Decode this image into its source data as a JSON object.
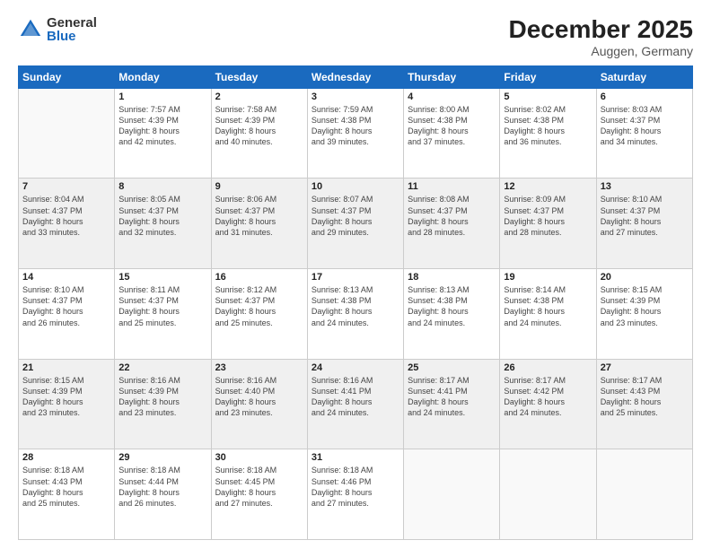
{
  "logo": {
    "general": "General",
    "blue": "Blue"
  },
  "title": "December 2025",
  "location": "Auggen, Germany",
  "days_of_week": [
    "Sunday",
    "Monday",
    "Tuesday",
    "Wednesday",
    "Thursday",
    "Friday",
    "Saturday"
  ],
  "weeks": [
    [
      {
        "num": "",
        "info": ""
      },
      {
        "num": "1",
        "info": "Sunrise: 7:57 AM\nSunset: 4:39 PM\nDaylight: 8 hours\nand 42 minutes."
      },
      {
        "num": "2",
        "info": "Sunrise: 7:58 AM\nSunset: 4:39 PM\nDaylight: 8 hours\nand 40 minutes."
      },
      {
        "num": "3",
        "info": "Sunrise: 7:59 AM\nSunset: 4:38 PM\nDaylight: 8 hours\nand 39 minutes."
      },
      {
        "num": "4",
        "info": "Sunrise: 8:00 AM\nSunset: 4:38 PM\nDaylight: 8 hours\nand 37 minutes."
      },
      {
        "num": "5",
        "info": "Sunrise: 8:02 AM\nSunset: 4:38 PM\nDaylight: 8 hours\nand 36 minutes."
      },
      {
        "num": "6",
        "info": "Sunrise: 8:03 AM\nSunset: 4:37 PM\nDaylight: 8 hours\nand 34 minutes."
      }
    ],
    [
      {
        "num": "7",
        "info": "Sunrise: 8:04 AM\nSunset: 4:37 PM\nDaylight: 8 hours\nand 33 minutes."
      },
      {
        "num": "8",
        "info": "Sunrise: 8:05 AM\nSunset: 4:37 PM\nDaylight: 8 hours\nand 32 minutes."
      },
      {
        "num": "9",
        "info": "Sunrise: 8:06 AM\nSunset: 4:37 PM\nDaylight: 8 hours\nand 31 minutes."
      },
      {
        "num": "10",
        "info": "Sunrise: 8:07 AM\nSunset: 4:37 PM\nDaylight: 8 hours\nand 29 minutes."
      },
      {
        "num": "11",
        "info": "Sunrise: 8:08 AM\nSunset: 4:37 PM\nDaylight: 8 hours\nand 28 minutes."
      },
      {
        "num": "12",
        "info": "Sunrise: 8:09 AM\nSunset: 4:37 PM\nDaylight: 8 hours\nand 28 minutes."
      },
      {
        "num": "13",
        "info": "Sunrise: 8:10 AM\nSunset: 4:37 PM\nDaylight: 8 hours\nand 27 minutes."
      }
    ],
    [
      {
        "num": "14",
        "info": "Sunrise: 8:10 AM\nSunset: 4:37 PM\nDaylight: 8 hours\nand 26 minutes."
      },
      {
        "num": "15",
        "info": "Sunrise: 8:11 AM\nSunset: 4:37 PM\nDaylight: 8 hours\nand 25 minutes."
      },
      {
        "num": "16",
        "info": "Sunrise: 8:12 AM\nSunset: 4:37 PM\nDaylight: 8 hours\nand 25 minutes."
      },
      {
        "num": "17",
        "info": "Sunrise: 8:13 AM\nSunset: 4:38 PM\nDaylight: 8 hours\nand 24 minutes."
      },
      {
        "num": "18",
        "info": "Sunrise: 8:13 AM\nSunset: 4:38 PM\nDaylight: 8 hours\nand 24 minutes."
      },
      {
        "num": "19",
        "info": "Sunrise: 8:14 AM\nSunset: 4:38 PM\nDaylight: 8 hours\nand 24 minutes."
      },
      {
        "num": "20",
        "info": "Sunrise: 8:15 AM\nSunset: 4:39 PM\nDaylight: 8 hours\nand 23 minutes."
      }
    ],
    [
      {
        "num": "21",
        "info": "Sunrise: 8:15 AM\nSunset: 4:39 PM\nDaylight: 8 hours\nand 23 minutes."
      },
      {
        "num": "22",
        "info": "Sunrise: 8:16 AM\nSunset: 4:39 PM\nDaylight: 8 hours\nand 23 minutes."
      },
      {
        "num": "23",
        "info": "Sunrise: 8:16 AM\nSunset: 4:40 PM\nDaylight: 8 hours\nand 23 minutes."
      },
      {
        "num": "24",
        "info": "Sunrise: 8:16 AM\nSunset: 4:41 PM\nDaylight: 8 hours\nand 24 minutes."
      },
      {
        "num": "25",
        "info": "Sunrise: 8:17 AM\nSunset: 4:41 PM\nDaylight: 8 hours\nand 24 minutes."
      },
      {
        "num": "26",
        "info": "Sunrise: 8:17 AM\nSunset: 4:42 PM\nDaylight: 8 hours\nand 24 minutes."
      },
      {
        "num": "27",
        "info": "Sunrise: 8:17 AM\nSunset: 4:43 PM\nDaylight: 8 hours\nand 25 minutes."
      }
    ],
    [
      {
        "num": "28",
        "info": "Sunrise: 8:18 AM\nSunset: 4:43 PM\nDaylight: 8 hours\nand 25 minutes."
      },
      {
        "num": "29",
        "info": "Sunrise: 8:18 AM\nSunset: 4:44 PM\nDaylight: 8 hours\nand 26 minutes."
      },
      {
        "num": "30",
        "info": "Sunrise: 8:18 AM\nSunset: 4:45 PM\nDaylight: 8 hours\nand 27 minutes."
      },
      {
        "num": "31",
        "info": "Sunrise: 8:18 AM\nSunset: 4:46 PM\nDaylight: 8 hours\nand 27 minutes."
      },
      {
        "num": "",
        "info": ""
      },
      {
        "num": "",
        "info": ""
      },
      {
        "num": "",
        "info": ""
      }
    ]
  ]
}
